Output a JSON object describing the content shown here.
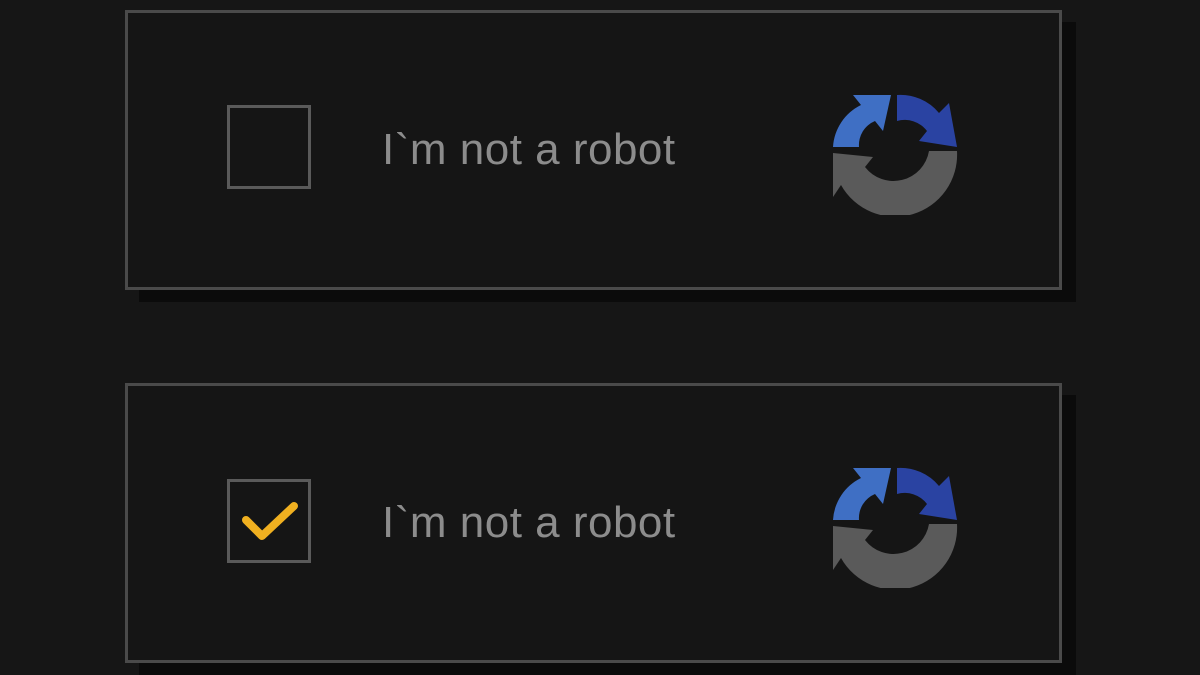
{
  "widgets": [
    {
      "label": "I`m not a robot",
      "checked": false,
      "logo_icon": "recaptcha-icon"
    },
    {
      "label": "I`m not a robot",
      "checked": true,
      "check_icon": "checkmark-icon",
      "logo_icon": "recaptcha-icon"
    }
  ],
  "colors": {
    "background": "#161616",
    "border": "#4a4a4a",
    "text": "#8c8c8c",
    "checkmark": "#f0b020",
    "logo_blue_light": "#3f6fc4",
    "logo_blue_dark": "#2a43a2",
    "logo_gray": "#5a5a5a"
  }
}
